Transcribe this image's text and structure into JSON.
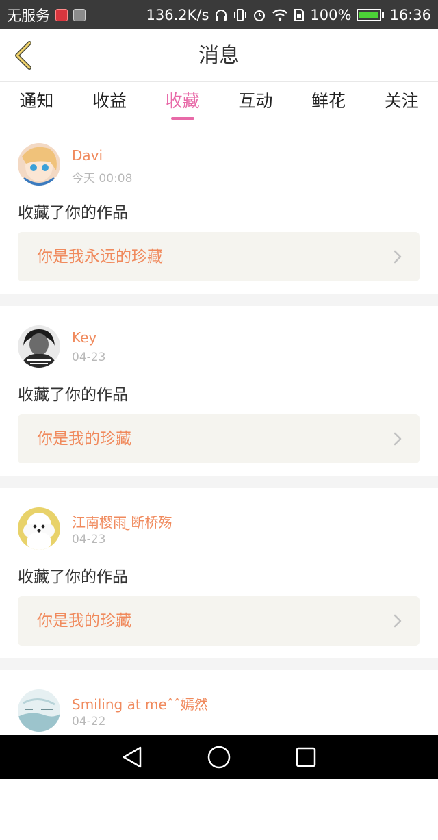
{
  "status_bar": {
    "carrier": "无服务",
    "speed": "136.2K/s",
    "battery": "100%",
    "time": "16:36"
  },
  "header": {
    "title": "消息"
  },
  "tabs": [
    {
      "label": "通知"
    },
    {
      "label": "收益"
    },
    {
      "label": "收藏"
    },
    {
      "label": "互动"
    },
    {
      "label": "鲜花"
    },
    {
      "label": "关注"
    }
  ],
  "active_tab": "收藏",
  "colors": {
    "accent": "#e86aa8",
    "orange": "#f08a5d"
  },
  "messages": [
    {
      "user": "Davi",
      "time": "今天 00:08",
      "action": "收藏了你的作品",
      "work": "你是我永远的珍藏"
    },
    {
      "user": "Key",
      "time": "04-23",
      "action": "收藏了你的作品",
      "work": "你是我的珍藏"
    },
    {
      "user": "江南樱雨 ̤̮断桥殇",
      "time": "04-23",
      "action": "收藏了你的作品",
      "work": "你是我的珍藏"
    },
    {
      "user": "Smiling at meˆˆ嫣然",
      "time": "04-22"
    }
  ]
}
